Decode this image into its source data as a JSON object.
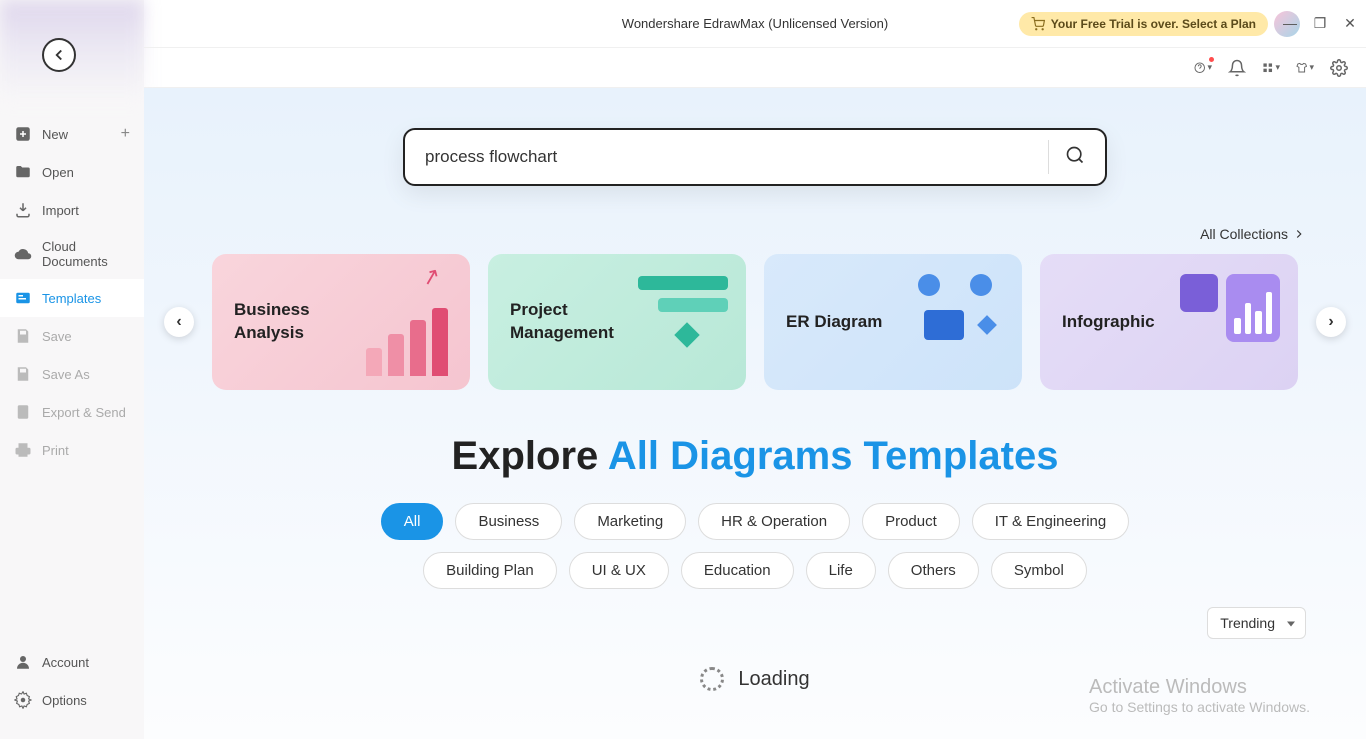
{
  "app_title": "Wondershare EdrawMax (Unlicensed Version)",
  "trial_banner": "Your Free Trial is over. Select a Plan",
  "sidebar": {
    "items": [
      {
        "label": "New",
        "icon": "plus-square",
        "has_plus": true
      },
      {
        "label": "Open",
        "icon": "folder"
      },
      {
        "label": "Import",
        "icon": "import"
      },
      {
        "label": "Cloud Documents",
        "icon": "cloud"
      },
      {
        "label": "Templates",
        "icon": "templates",
        "active": true
      },
      {
        "label": "Save",
        "icon": "save",
        "disabled": true
      },
      {
        "label": "Save As",
        "icon": "save-as",
        "disabled": true
      },
      {
        "label": "Export & Send",
        "icon": "export",
        "disabled": true
      },
      {
        "label": "Print",
        "icon": "print",
        "disabled": true
      }
    ],
    "bottom": [
      {
        "label": "Account",
        "icon": "account"
      },
      {
        "label": "Options",
        "icon": "gear"
      }
    ]
  },
  "search": {
    "value": "process flowchart"
  },
  "all_collections_label": "All Collections",
  "cards": [
    {
      "title": "Business Analysis"
    },
    {
      "title": "Project Management"
    },
    {
      "title": "ER Diagram"
    },
    {
      "title": "Infographic"
    }
  ],
  "explore": {
    "prefix": "Explore ",
    "highlight": "All Diagrams Templates"
  },
  "filters": [
    "All",
    "Business",
    "Marketing",
    "HR & Operation",
    "Product",
    "IT & Engineering",
    "Building Plan",
    "UI & UX",
    "Education",
    "Life",
    "Others",
    "Symbol"
  ],
  "active_filter": "All",
  "sort": {
    "selected": "Trending"
  },
  "loading_label": "Loading",
  "watermark": {
    "line1": "Activate Windows",
    "line2": "Go to Settings to activate Windows."
  }
}
